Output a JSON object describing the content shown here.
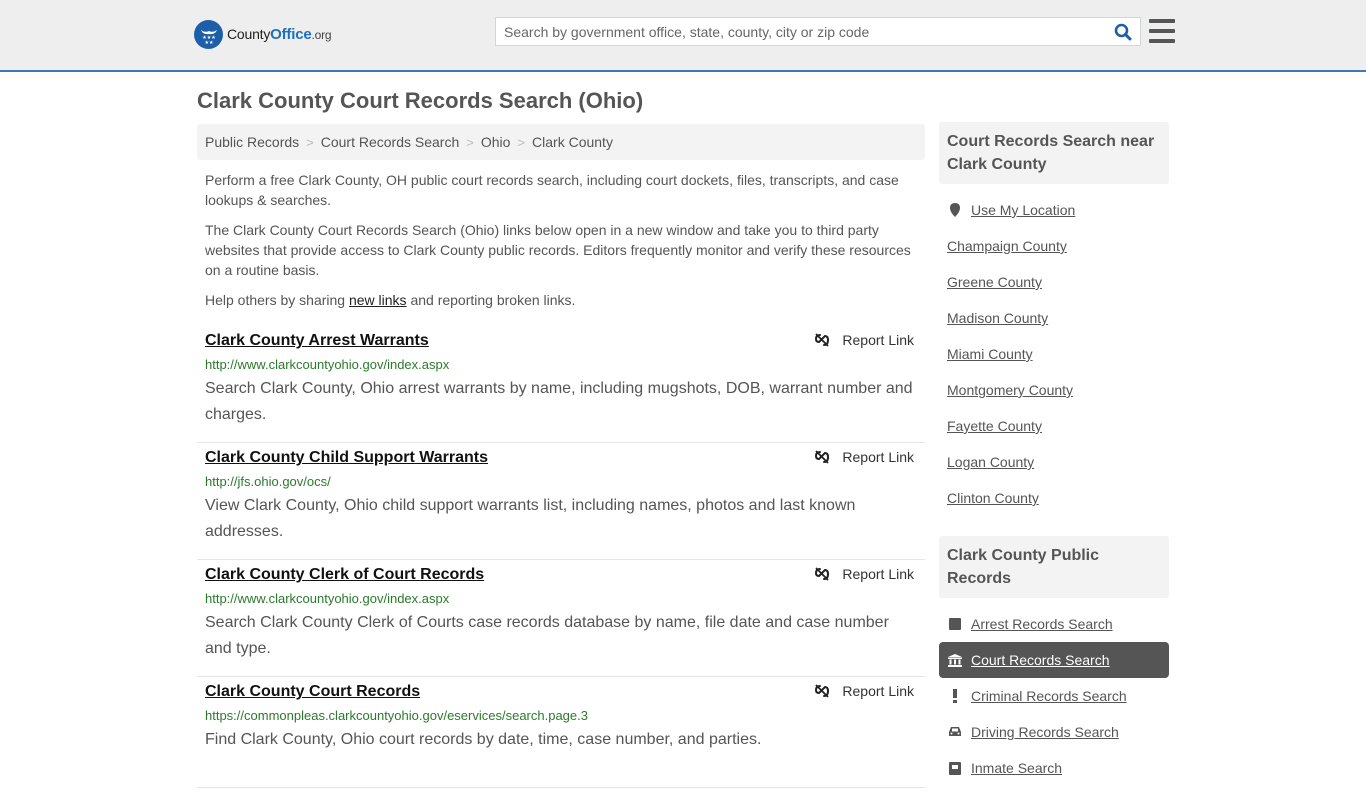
{
  "header": {
    "logo": {
      "name": "County",
      "highlight": "Office",
      "tld": ".org"
    },
    "search": {
      "placeholder": "Search by government office, state, county, city or zip code",
      "value": ""
    },
    "colors": {
      "accent": "#3b7bb5",
      "brand_blue": "#1d5ea8"
    }
  },
  "page": {
    "title": "Clark County Court Records Search (Ohio)"
  },
  "breadcrumb": [
    {
      "label": "Public Records"
    },
    {
      "label": "Court Records Search"
    },
    {
      "label": "Ohio"
    },
    {
      "label": "Clark County"
    }
  ],
  "intro": {
    "p1": "Perform a free Clark County, OH public court records search, including court dockets, files, transcripts, and case lookups & searches.",
    "p2": "The Clark County Court Records Search (Ohio) links below open in a new window and take you to third party websites that provide access to Clark County public records. Editors frequently monitor and verify these resources on a routine basis.",
    "p3_before": "Help others by sharing ",
    "p3_link": "new links",
    "p3_after": " and reporting broken links."
  },
  "results": [
    {
      "title": "Clark County Arrest Warrants",
      "url": "http://www.clarkcountyohio.gov/index.aspx",
      "description": "Search Clark County, Ohio arrest warrants by name, including mugshots, DOB, warrant number and charges.",
      "report_label": "Report Link"
    },
    {
      "title": "Clark County Child Support Warrants",
      "url": "http://jfs.ohio.gov/ocs/",
      "description": "View Clark County, Ohio child support warrants list, including names, photos and last known addresses.",
      "report_label": "Report Link"
    },
    {
      "title": "Clark County Clerk of Court Records",
      "url": "http://www.clarkcountyohio.gov/index.aspx",
      "description": "Search Clark County Clerk of Courts case records database by name, file date and case number and type.",
      "report_label": "Report Link"
    },
    {
      "title": "Clark County Court Records",
      "url": "https://commonpleas.clarkcountyohio.gov/eservices/search.page.3",
      "description": "Find Clark County, Ohio court records by date, time, case number, and parties.",
      "report_label": "Report Link"
    }
  ],
  "sidebar": {
    "nearby": {
      "heading": "Court Records Search near Clark County",
      "use_location": "Use My Location",
      "counties": [
        "Champaign County",
        "Greene County",
        "Madison County",
        "Miami County",
        "Montgomery County",
        "Fayette County",
        "Logan County",
        "Clinton County"
      ]
    },
    "public_records": {
      "heading": "Clark County Public Records",
      "items": [
        {
          "label": "Arrest Records Search",
          "icon": "square-icon",
          "active": false
        },
        {
          "label": "Court Records Search",
          "icon": "courthouse-icon",
          "active": true
        },
        {
          "label": "Criminal Records Search",
          "icon": "exclamation-icon",
          "active": false
        },
        {
          "label": "Driving Records Search",
          "icon": "car-icon",
          "active": false
        },
        {
          "label": "Inmate Search",
          "icon": "inmate-icon",
          "active": false
        }
      ]
    }
  }
}
